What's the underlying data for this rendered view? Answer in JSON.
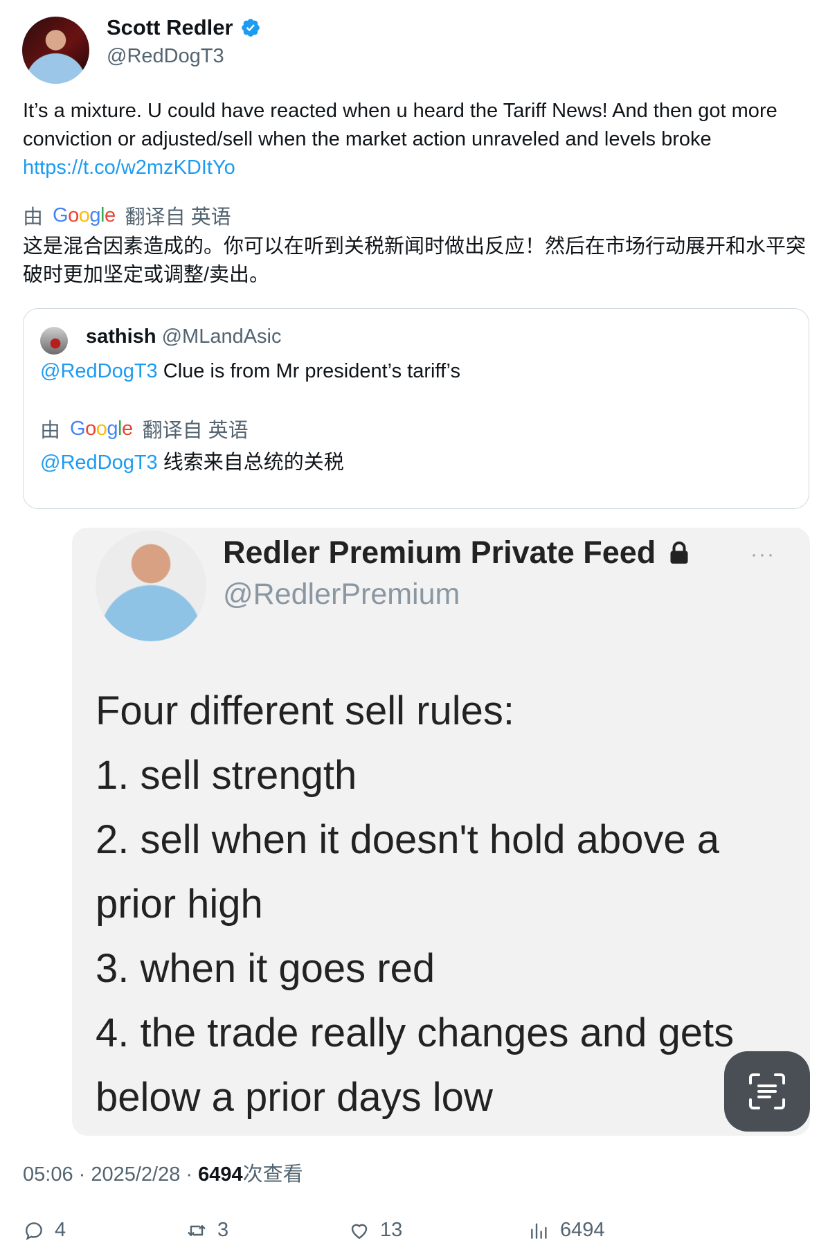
{
  "author": {
    "name": "Scott Redler",
    "handle": "@RedDogT3"
  },
  "tweet": {
    "text": "It’s a mixture. U could have reacted when u heard the Tariff News!  And then got more conviction or adjusted/sell when the market action unraveled and levels broke ",
    "link": "https://t.co/w2mzKDItYo"
  },
  "translation": {
    "prefix": "由",
    "provider": "Google",
    "suffix": "翻译自 英语",
    "text": "这是混合因素造成的。你可以在听到关税新闻时做出反应！然后在市场行动展开和水平突破时更加坚定或调整/卖出。"
  },
  "quote": {
    "name": "sathish",
    "handle": "@MLandAsic",
    "mention": "@RedDogT3",
    "text": " Clue is from  Mr president’s tariff’s",
    "translation_prefix": "由",
    "translation_provider": "Google",
    "translation_suffix": "翻译自 英语",
    "translation_mention": "@RedDogT3",
    "translation_text": " 线索来自总统的关税"
  },
  "media": {
    "name": "Redler Premium Private Feed",
    "handle": "@RedlerPremium",
    "more": "···",
    "lines": [
      "Four different sell rules:",
      "1. sell strength",
      "2. sell when it doesn't hold above a prior high",
      "3. when it goes red",
      "4. the trade really changes and gets below a prior days low"
    ]
  },
  "meta": {
    "time": "05:06 · 2025/2/28 · ",
    "views_count": "6494",
    "views_label": "次查看"
  },
  "actions": {
    "replies": "4",
    "reposts": "3",
    "likes": "13",
    "views": "6494"
  },
  "colors": {
    "link": "#1d9bf0",
    "secondary_text": "#536471",
    "primary_text": "#0f1419"
  }
}
